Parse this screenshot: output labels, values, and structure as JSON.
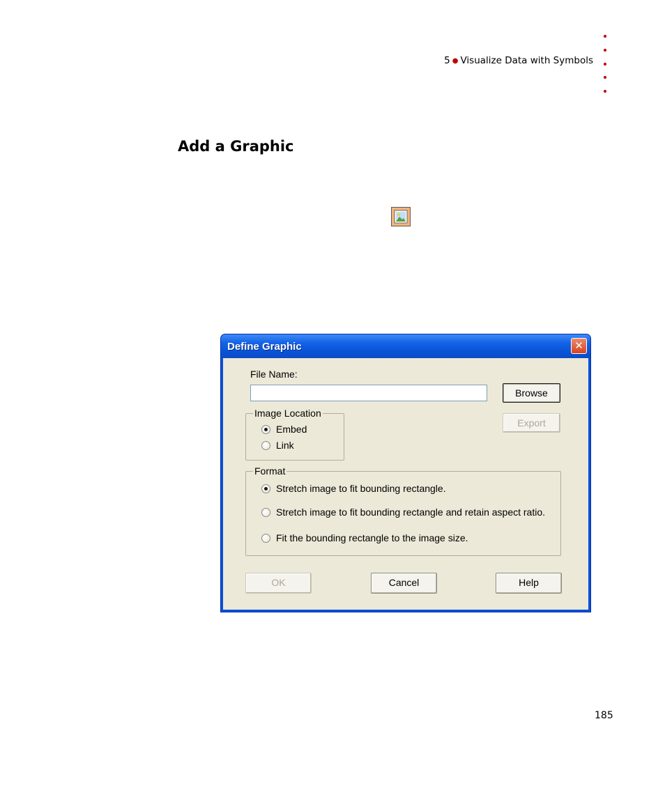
{
  "page": {
    "chapter_number": "5",
    "chapter_title": "Visualize Data with Symbols",
    "section_title": "Add a Graphic",
    "page_number": "185",
    "tool_icon": "insert-graphic-icon",
    "accent_color": "#c00000"
  },
  "dialog": {
    "title": "Define Graphic",
    "close_label": "✕",
    "file_name_label": "File Name:",
    "file_name_value": "",
    "file_name_placeholder": "",
    "browse_label": "Browse",
    "export_label": "Export",
    "image_location": {
      "legend": "Image Location",
      "options": [
        {
          "label": "Embed",
          "checked": true
        },
        {
          "label": "Link",
          "checked": false
        }
      ]
    },
    "format": {
      "legend": "Format",
      "options": [
        {
          "label": "Stretch image to fit bounding rectangle.",
          "checked": true
        },
        {
          "label": "Stretch image to fit bounding rectangle and retain aspect ratio.",
          "checked": false
        },
        {
          "label": "Fit the bounding rectangle to the image size.",
          "checked": false
        }
      ]
    },
    "ok_label": "OK",
    "cancel_label": "Cancel",
    "help_label": "Help"
  }
}
